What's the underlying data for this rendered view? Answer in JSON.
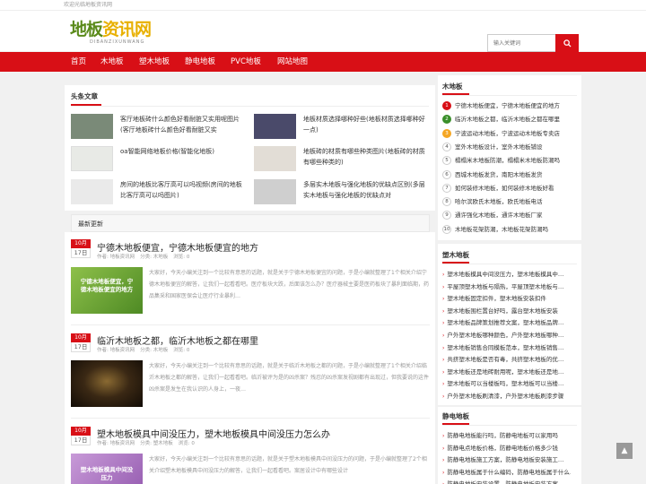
{
  "topbar": {
    "text": "欢迎光临地板资讯网"
  },
  "logo": {
    "part1": "地板",
    "part2": "资讯网",
    "sub": "DIBANZIXUNWANG"
  },
  "search": {
    "placeholder": "输入关键词"
  },
  "nav": [
    "首页",
    "木地板",
    "塑木地板",
    "静电地板",
    "PVC地板",
    "网站地图"
  ],
  "headline": {
    "title": "头条文章",
    "items": [
      {
        "text": "客厅地板砖什么颜色好看耐脏又实用呢图片(客厅地板砖什么颜色好看耐脏又实",
        "thumb_color": "#7a8a78"
      },
      {
        "text": "地板材质选择哪种好些(地板材质选择哪种好一点)",
        "thumb_color": "#4a4a6a"
      },
      {
        "text": "oa智能网络地板价格(智能化地板)",
        "thumb_color": "#e8eae6"
      },
      {
        "text": "地板砖的材质有哪些种类图片(地板砖的材质有哪些种类的)",
        "thumb_color": "#e2ddd6"
      },
      {
        "text": "房间的地板比客厅高可以吗视频(房间的地板比客厅高可以吗图片)",
        "thumb_color": "#eaeaea"
      },
      {
        "text": "多层实木地板与强化地板的优缺点区别(多层实木地板与强化地板的优缺点对",
        "thumb_color": "#cfcfcf"
      }
    ]
  },
  "latest": {
    "title": "最新更新",
    "meta_labels": {
      "author": "作者: 地板资讯网",
      "category_prefix": "分类: ",
      "views": "浏览: 0"
    },
    "posts": [
      {
        "month": "10月",
        "day": "17日",
        "title": "宁德木地板便宜，宁德木地板便宜的地方",
        "category": "木地板",
        "excerpt": "大家好，今天小编关注到一个比较有意思的话题，就是关于宁德木地板便宜的问题，于是小编就整理了1个相关介绍宁德木地板便宜的解答，让我们一起看看吧。医疗板块大跌，后面该怎么办？医疗器械主要是医药板块了暴利面临期，药品集采和国家医保会让医疗行业暴利…",
        "thumb_text": "宁德木地板便宜，宁德木地板便宜的地方",
        "thumb_color": "#6aa33a"
      },
      {
        "month": "10月",
        "day": "17日",
        "title": "临沂木地板之都，临沂木地板之都在哪里",
        "category": "木地板",
        "excerpt": "大家好，今天小编关注到一个比较有意思的话题，就是关于临沂木地板之都的问题，于是小编就整理了1个相关介绍临沂木地板之都的解答，让我们一起看看吧。临沂被评为是的凶杀案？残忍的凶杀案发视剧都有出现过，但我要说的这件凶杀案是发生在我认识的人身上，一夜…",
        "thumb_text": "",
        "thumb_color": "#2a1e12"
      },
      {
        "month": "10月",
        "day": "17日",
        "title": "塑木地板模具中间没压力，塑木地板模具中间没压力怎么办",
        "category": "塑木地板",
        "excerpt": "大家好，今天小编关注到一个比较有意思的话题，就是关于塑木地板模具中间没压力的问题，于是小编就整理了2个相关介绍塑木地板模具中间没压力的解答，让我们一起看看吧。案居设计中有哪些设计",
        "thumb_text": "塑木地板模具中间没压力",
        "thumb_color": "#b07ac4"
      }
    ]
  },
  "sidebar": {
    "wood": {
      "title": "木地板",
      "items": [
        "宁德木地板便宜，宁德木地板便宜的地方",
        "临沂木地板之都，临沂木地板之都在哪里",
        "宁波运动木地板，宁波运动木地板专卖店",
        "室外木地板设计，室外木地板铺设",
        "榻榻米木地板防潮，榻榻米木地板防潮吗",
        "西城木地板发货，南阳木地板发货",
        "如何装修木地板，如何装修木地板好看",
        "哈尔滨欧氏木地板，欧氏地板电话",
        "通许强化木地板，通许木地板厂家",
        "木地板花架防潮，木地板花架防潮吗"
      ]
    },
    "plastic": {
      "title": "塑木地板",
      "items": [
        "塑木地板模具中间没压力，塑木地板模具中…",
        "平屋顶塑木地板与隔热，平屋顶塑木地板与…",
        "塑木地板固定扣件，塑木地板安装扣件",
        "塑木地板围栏置台好吗，露台塑木地板安装",
        "塑木地板品牌策划推荐文案，塑木地板品牌…",
        "户外塑木地板哪种颜色，户外塑木地板哪种…",
        "塑木地板销售合同模板范本，塑木地板销售…",
        "共挤塑木地板是否有毒，共挤塑木地板的优…",
        "塑木地板还是地砖耐用呢，塑木地板还是地…",
        "塑木地板可以当楼板吗，塑木地板可以当楼…",
        "户外塑木地板刷清漆，户外塑木地板刷漆步骤"
      ]
    },
    "static": {
      "title": "静电地板",
      "items": [
        "防静电地板能行吗，防静电地板可以家用吗",
        "防静电点地板价格，防静电地板价格多少钱",
        "防静电地板施工方案，防静电地板安装施工…",
        "防静电地板属于什么编码，防静电地板属于什么…",
        "防静电地板安装设置，防静电地板安装方案"
      ]
    }
  },
  "rank_colors": [
    "#d80f16",
    "#3a8f2a",
    "#f5a623"
  ],
  "backtop": {
    "label": "▲"
  }
}
